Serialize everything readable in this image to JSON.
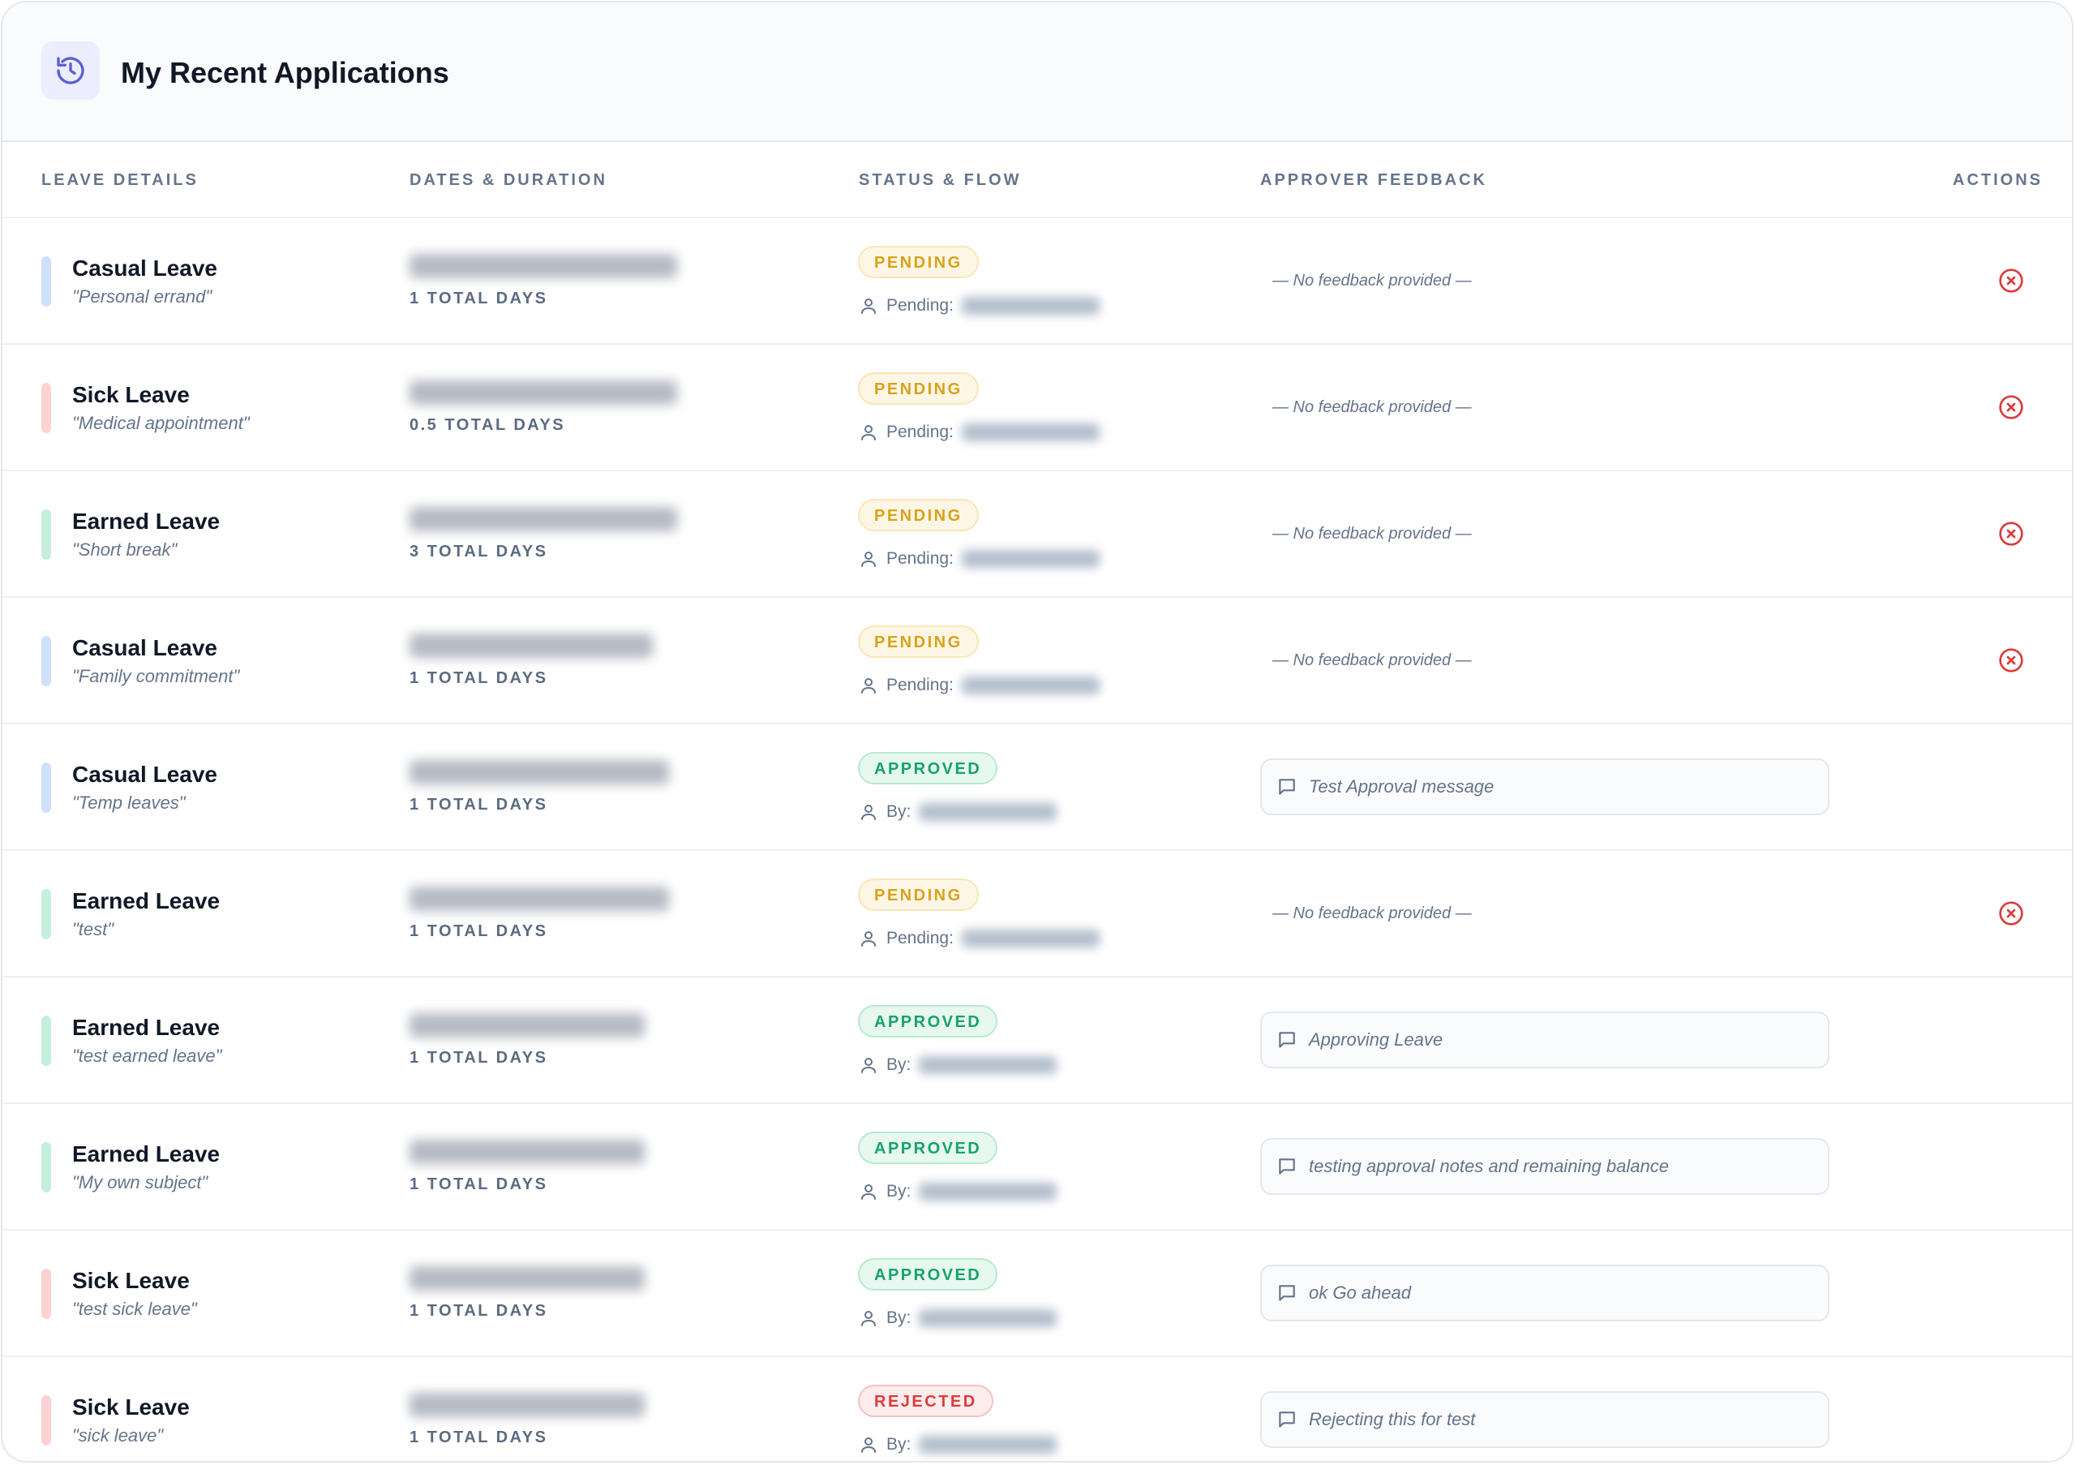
{
  "header": {
    "title": "My Recent Applications",
    "icon": "history-icon"
  },
  "columns": {
    "leave_details": "LEAVE DETAILS",
    "dates_duration": "DATES & DURATION",
    "status_flow": "STATUS & FLOW",
    "approver_feedback": "APPROVER FEEDBACK",
    "actions": "ACTIONS"
  },
  "colors": {
    "casual": "#cfe0fc",
    "sick": "#fcd2d2",
    "earned": "#c6eedc"
  },
  "rows": [
    {
      "type": "Casual Leave",
      "kind": "casual",
      "reason": "\"Personal errand\"",
      "duration": "1 TOTAL DAYS",
      "status": "PENDING",
      "status_class": "pending",
      "flow_label": "Pending:",
      "feedback": "— No feedback provided —",
      "has_feedback": false,
      "cancellable": true
    },
    {
      "type": "Sick Leave",
      "kind": "sick",
      "reason": "\"Medical appointment\"",
      "duration": "0.5 TOTAL DAYS",
      "status": "PENDING",
      "status_class": "pending",
      "flow_label": "Pending:",
      "feedback": "— No feedback provided —",
      "has_feedback": false,
      "cancellable": true
    },
    {
      "type": "Earned Leave",
      "kind": "earned",
      "reason": "\"Short break\"",
      "duration": "3 TOTAL DAYS",
      "status": "PENDING",
      "status_class": "pending",
      "flow_label": "Pending:",
      "feedback": "— No feedback provided —",
      "has_feedback": false,
      "cancellable": true
    },
    {
      "type": "Casual Leave",
      "kind": "casual",
      "reason": "\"Family commitment\"",
      "duration": "1 TOTAL DAYS",
      "status": "PENDING",
      "status_class": "pending",
      "flow_label": "Pending:",
      "feedback": "— No feedback provided —",
      "has_feedback": false,
      "cancellable": true
    },
    {
      "type": "Casual Leave",
      "kind": "casual",
      "reason": "\"Temp leaves\"",
      "duration": "1 TOTAL DAYS",
      "status": "APPROVED",
      "status_class": "approved",
      "flow_label": "By:",
      "feedback": "Test Approval message",
      "has_feedback": true,
      "cancellable": false
    },
    {
      "type": "Earned Leave",
      "kind": "earned",
      "reason": "\"test\"",
      "duration": "1 TOTAL DAYS",
      "status": "PENDING",
      "status_class": "pending",
      "flow_label": "Pending:",
      "feedback": "— No feedback provided —",
      "has_feedback": false,
      "cancellable": true
    },
    {
      "type": "Earned Leave",
      "kind": "earned",
      "reason": "\"test earned leave\"",
      "duration": "1 TOTAL DAYS",
      "status": "APPROVED",
      "status_class": "approved",
      "flow_label": "By:",
      "feedback": "Approving Leave",
      "has_feedback": true,
      "cancellable": false
    },
    {
      "type": "Earned Leave",
      "kind": "earned",
      "reason": "\"My own subject\"",
      "duration": "1 TOTAL DAYS",
      "status": "APPROVED",
      "status_class": "approved",
      "flow_label": "By:",
      "feedback": "testing approval notes and remaining balance",
      "has_feedback": true,
      "cancellable": false
    },
    {
      "type": "Sick Leave",
      "kind": "sick",
      "reason": "\"test sick leave\"",
      "duration": "1 TOTAL DAYS",
      "status": "APPROVED",
      "status_class": "approved",
      "flow_label": "By:",
      "feedback": "ok Go ahead",
      "has_feedback": true,
      "cancellable": false
    },
    {
      "type": "Sick Leave",
      "kind": "sick",
      "reason": "\"sick leave\"",
      "duration": "1 TOTAL DAYS",
      "status": "REJECTED",
      "status_class": "rejected",
      "flow_label": "By:",
      "feedback": "Rejecting this for test",
      "has_feedback": true,
      "cancellable": false
    }
  ]
}
